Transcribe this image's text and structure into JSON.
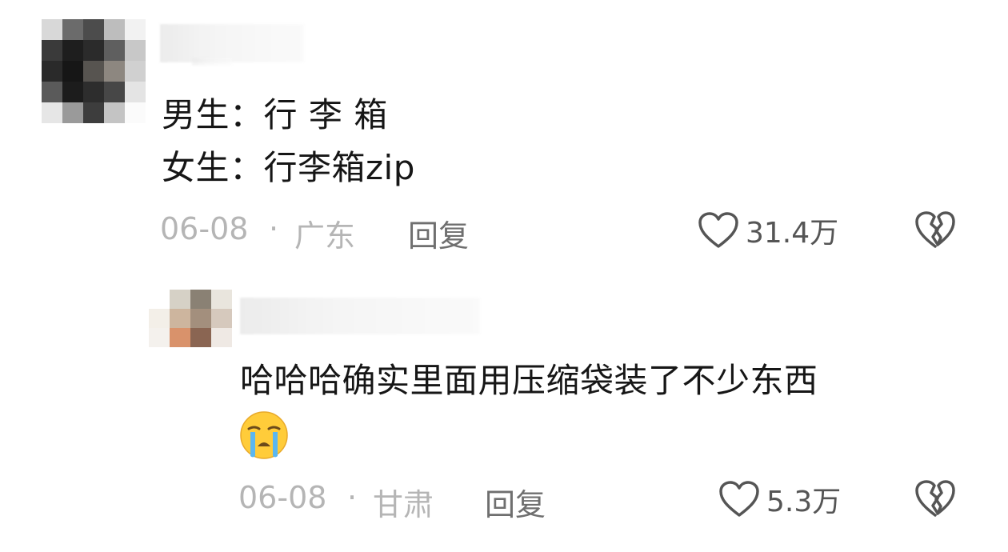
{
  "comments": [
    {
      "lines": [
        "男生：行 李 箱",
        "女生：行李箱zip"
      ],
      "date": "06-08",
      "separator": "·",
      "location": "广东",
      "reply_label": "回复",
      "likes": "31.4万"
    },
    {
      "lines": [
        "哈哈哈确实里面用压缩袋装了不少东西"
      ],
      "date": "06-08",
      "separator": "·",
      "location": "甘肃",
      "reply_label": "回复",
      "likes": "5.3万",
      "emoji": "loudly-crying-face"
    }
  ],
  "colors": {
    "text": "#161616",
    "meta": "#b5b5b5",
    "reply": "#6f6f6f",
    "icon": "#555555"
  }
}
